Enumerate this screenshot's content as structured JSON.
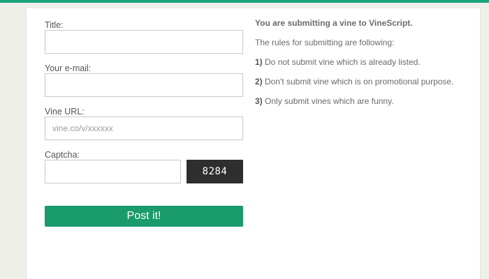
{
  "form": {
    "title_label": "Title:",
    "title_value": "",
    "email_label": "Your e-mail:",
    "email_value": "",
    "url_label": "Vine URL:",
    "url_placeholder": "vine.co/v/xxxxxx",
    "captcha_label": "Captcha:",
    "captcha_value": "",
    "captcha_code": "8284",
    "submit_label": "Post it!"
  },
  "rules": {
    "heading": "You are submitting a vine to VineScript.",
    "intro": "The rules for submitting are following:",
    "items": [
      {
        "num": "1)",
        "text": "Do not submit vine which is already listed."
      },
      {
        "num": "2)",
        "text": "Don't submit vine which is on promotional purpose."
      },
      {
        "num": "3)",
        "text": "Only submit vines which are funny."
      }
    ]
  },
  "colors": {
    "accent": "#1aa67d",
    "button": "#199b6b",
    "captcha_bg": "#2e2e2e",
    "background": "#efefea"
  }
}
